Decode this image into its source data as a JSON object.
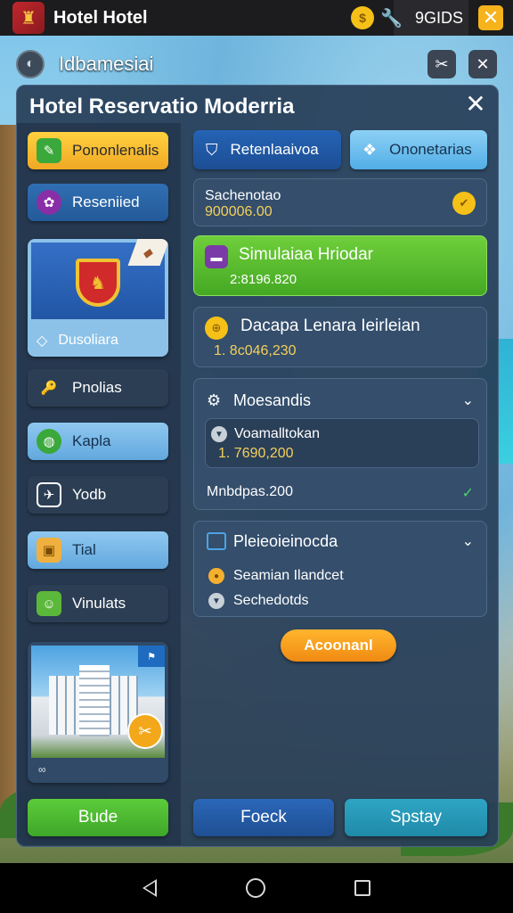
{
  "statusbar": {
    "title": "Hotel Hotel",
    "tools_label": "9GIDS"
  },
  "location": {
    "text": "Idbamesiai"
  },
  "panel": {
    "title": "Hotel Reservatio Moderria"
  },
  "sidebar": {
    "items": [
      {
        "label": "Pononlenalis"
      },
      {
        "label": "Reseniied"
      },
      {
        "label": "Dusoliara"
      },
      {
        "label": "Pnolias"
      },
      {
        "label": "Kapla"
      },
      {
        "label": "Yodb"
      },
      {
        "label": "Tial"
      },
      {
        "label": "Vinulats"
      }
    ]
  },
  "tabs": {
    "left": "Retenlaaivoa",
    "right": "Ononetarias"
  },
  "summary": {
    "label": "Sachenotao",
    "value": "900006.00"
  },
  "featured": {
    "title": "Simulaiaa Hriodar",
    "value": "2:8196.820"
  },
  "balance": {
    "title": "Dacapa Lenara Ieirleian",
    "value": "1. 8c046,230"
  },
  "section_messages": {
    "title": "Moesandis",
    "inner_title": "Voamalltokan",
    "inner_value": "1. 7690,200",
    "footer": "Mnbdpas.200"
  },
  "section_reservations": {
    "title": "Pleieoieinocda",
    "items": [
      "Seamian Ilandcet",
      "Sechedotds"
    ]
  },
  "accent_button": "Acoonanl",
  "bottom_buttons": {
    "left": "Bude",
    "middle": "Foeck",
    "right": "Spstay"
  },
  "colors": {
    "accent": "#f0a824",
    "primary": "#245a98",
    "success": "#44a823",
    "panel": "#283e58"
  }
}
